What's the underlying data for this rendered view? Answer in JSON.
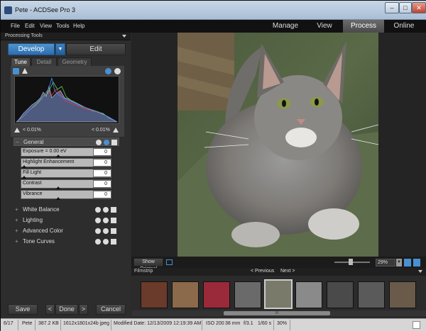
{
  "window": {
    "title": "Pete - ACDSee Pro 3",
    "controls": [
      "–",
      "□",
      "✕"
    ]
  },
  "menu": [
    "File",
    "Edit",
    "View",
    "Tools",
    "Help"
  ],
  "modes": [
    "Manage",
    "View",
    "Process",
    "Online"
  ],
  "active_mode": "Process",
  "panel": {
    "title": "Processing Tools"
  },
  "develop": {
    "develop_label": "Develop",
    "edit_label": "Edit"
  },
  "subtabs": [
    "Tune",
    "Detail",
    "Geometry"
  ],
  "clipping": {
    "left": "< 0.01%",
    "right": "< 0.01%"
  },
  "general": {
    "label": "General",
    "sliders": [
      {
        "label": "Exposure = 0.00 eV",
        "value": "0"
      },
      {
        "label": "Highlight Enhancement",
        "value": "0"
      },
      {
        "label": "Fill Light",
        "value": "0"
      },
      {
        "label": "Contrast",
        "value": "0"
      },
      {
        "label": "Vibrance",
        "value": "0"
      }
    ]
  },
  "sections": [
    "White Balance",
    "Lighting",
    "Advanced Color",
    "Tone Curves"
  ],
  "bottom_buttons": {
    "save": "Save",
    "prev": "<",
    "done": "Done",
    "next": ">",
    "cancel": "Cancel"
  },
  "image_toolbar": {
    "show_original": "Show Original",
    "zoom": "29%"
  },
  "filmstrip": {
    "label": "Filmstrip",
    "previous": "< Previous",
    "next": "Next >",
    "scroll": "III"
  },
  "status": {
    "index": "6/17",
    "name": "Pete",
    "size": "387.2 KB",
    "dims": "1612x1801x24b jpeg",
    "modified": "Modified Date: 12/13/2009 12:19:39 AM",
    "iso": "ISO 200",
    "focal": "38 mm",
    "fstop": "f/3.1",
    "shutter": "1/60 s",
    "zoom": "30%"
  }
}
